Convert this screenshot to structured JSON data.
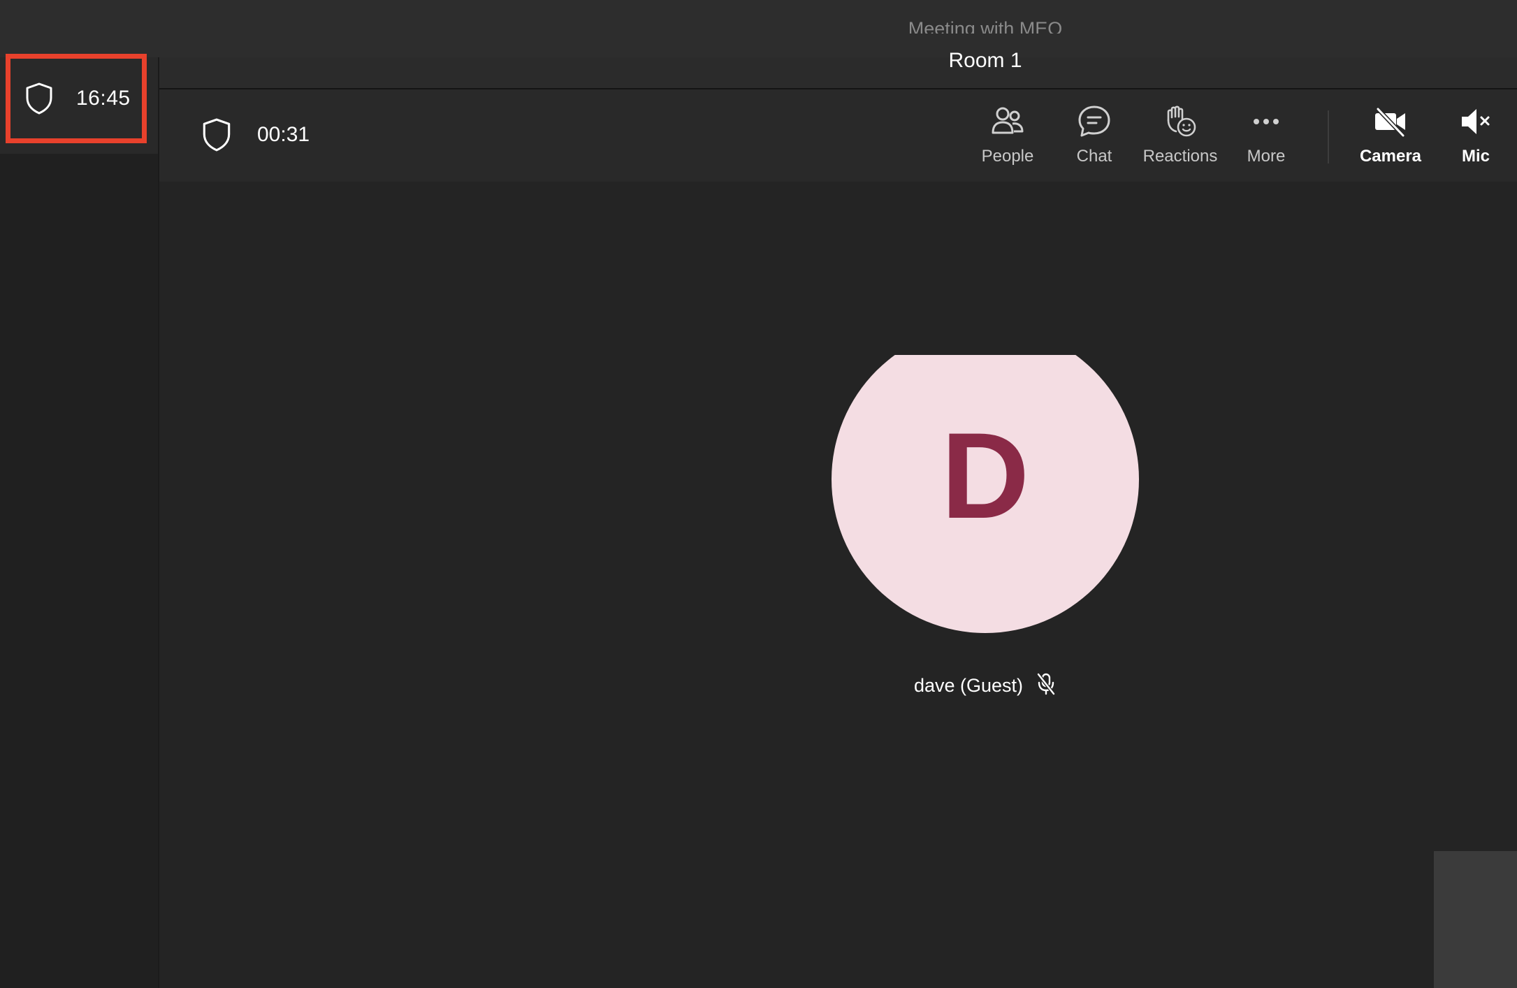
{
  "window": {
    "faded_title": "Meeting with MEO"
  },
  "highlighted": {
    "shield_icon": "shield-icon",
    "time": "16:45",
    "highlight_color": "#e8412c"
  },
  "room": {
    "title": "Room 1"
  },
  "toolbar": {
    "timer": "00:31",
    "buttons": [
      {
        "label": "People",
        "icon": "people-icon"
      },
      {
        "label": "Chat",
        "icon": "chat-icon"
      },
      {
        "label": "Reactions",
        "icon": "reactions-icon"
      },
      {
        "label": "More",
        "icon": "more-icon"
      },
      {
        "label": "Camera",
        "icon": "camera-off-icon"
      },
      {
        "label": "Mic",
        "icon": "mic-muted-icon"
      }
    ]
  },
  "participant": {
    "initial": "D",
    "name": "dave (Guest)",
    "avatar_bg": "#f4dde3",
    "avatar_fg": "#8a2a47",
    "mic_state_icon": "mic-muted-icon"
  }
}
